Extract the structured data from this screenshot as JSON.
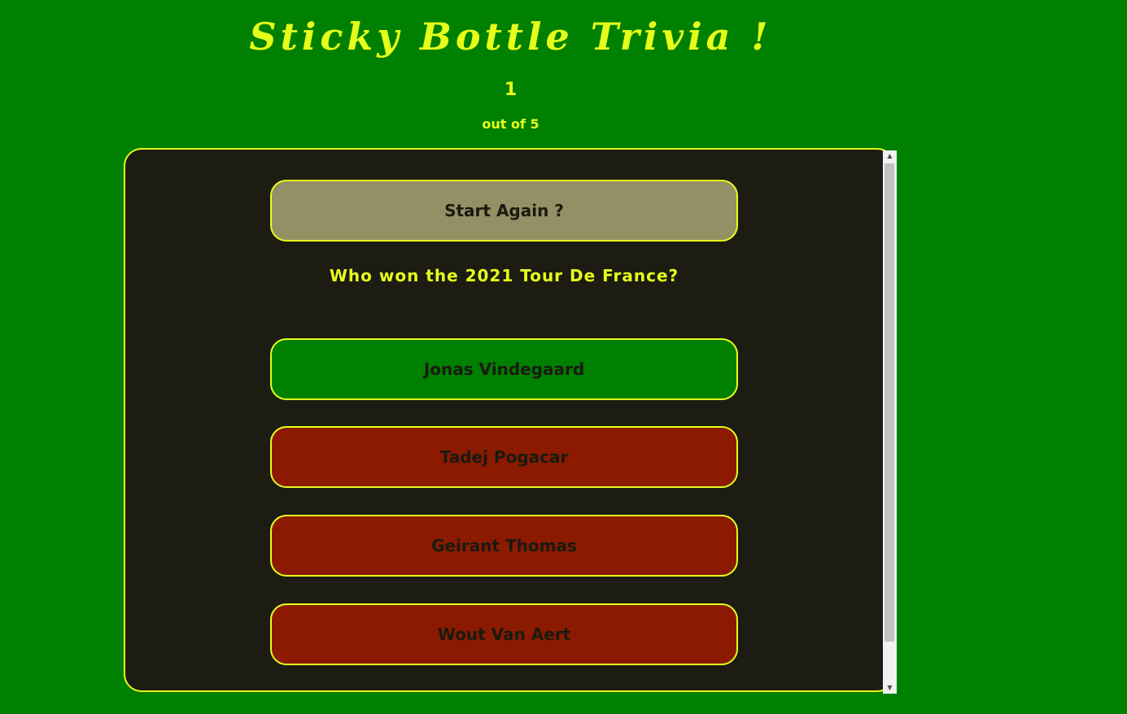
{
  "header": {
    "title": "Sticky Bottle Trivia !",
    "score": "1",
    "out_of": "out of 5"
  },
  "quiz": {
    "restart_label": "Start Again ?",
    "question": "Who won the 2021 Tour De France?",
    "answers": [
      {
        "label": "Jonas Vindegaard",
        "state": "correct"
      },
      {
        "label": "Tadej Pogacar",
        "state": "wrong"
      },
      {
        "label": "Geirant Thomas",
        "state": "wrong"
      },
      {
        "label": "Wout Van Aert",
        "state": "wrong"
      }
    ]
  },
  "colors": {
    "background": "#008000",
    "accent": "#e6ff1a",
    "panel": "#1c1c12",
    "restart": "#948f64",
    "correct": "#008000",
    "wrong": "#8b1a00"
  }
}
